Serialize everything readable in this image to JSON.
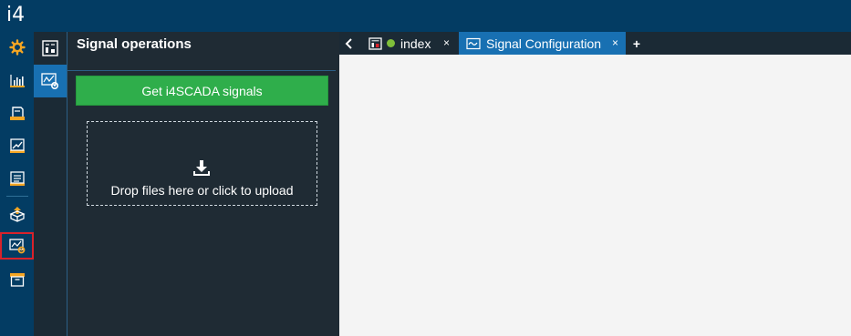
{
  "app": {
    "brand": "i4"
  },
  "colors": {
    "header_bg": "#033c63",
    "panel_bg": "#1f2b34",
    "accent_blue": "#1870b2",
    "accent_orange": "#f5a623",
    "green_button": "#2fae4b",
    "selection_outline": "#d9222a",
    "status_dot": "#7fbf3a"
  },
  "rail": {
    "items": [
      {
        "icon": "gear-icon"
      },
      {
        "icon": "bar-chart-icon"
      },
      {
        "icon": "printer-icon"
      },
      {
        "icon": "trend-chart-icon"
      },
      {
        "icon": "document-list-icon"
      },
      {
        "icon": "export-box-icon"
      },
      {
        "icon": "signal-config-icon",
        "selected": true
      },
      {
        "icon": "archive-icon"
      }
    ]
  },
  "subrail": {
    "items": [
      {
        "icon": "dashboard-grid-icon"
      },
      {
        "icon": "signal-config-icon",
        "active": true
      }
    ]
  },
  "panel": {
    "title": "Signal operations",
    "get_signals_label": "Get i4SCADA signals",
    "dropzone_text": "Drop files here or click to upload",
    "dropzone_icon": "download-icon"
  },
  "tabs": [
    {
      "label": "index",
      "icon": "dashboard-grid-icon",
      "status": "online",
      "close": "×"
    },
    {
      "label": "Signal Configuration",
      "icon": "wave-icon",
      "active": true,
      "close": "×"
    }
  ],
  "tabbar": {
    "add_label": "+",
    "back_icon": "chevron-left-icon"
  }
}
